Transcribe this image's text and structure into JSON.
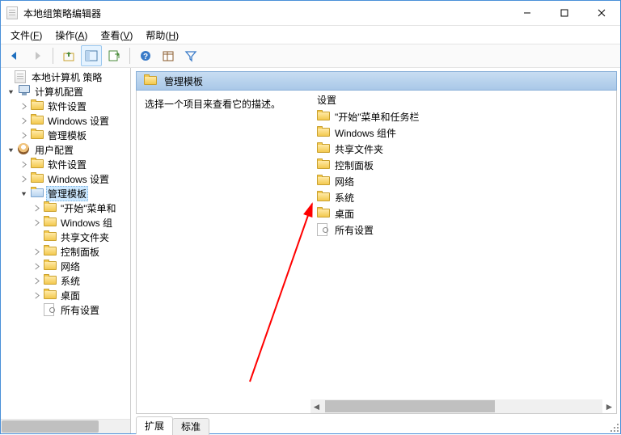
{
  "window": {
    "title": "本地组策略编辑器"
  },
  "menu": {
    "file": {
      "label": "文件",
      "accel": "F"
    },
    "action": {
      "label": "操作",
      "accel": "A"
    },
    "view": {
      "label": "查看",
      "accel": "V"
    },
    "help": {
      "label": "帮助",
      "accel": "H"
    }
  },
  "tree": {
    "root": {
      "label": "本地计算机 策略"
    },
    "computer_cfg": {
      "label": "计算机配置"
    },
    "computer_children": {
      "software": "软件设置",
      "windows": "Windows 设置",
      "admin": "管理模板"
    },
    "user_cfg": {
      "label": "用户配置"
    },
    "user_children": {
      "software": "软件设置",
      "windows": "Windows 设置",
      "admin": "管理模板"
    },
    "admin_children": {
      "startmenu": "\"开始\"菜单和",
      "win_comp": "Windows 组",
      "shared": "共享文件夹",
      "control": "控制面板",
      "network": "网络",
      "system": "系统",
      "desktop": "桌面",
      "all": "所有设置"
    }
  },
  "breadcrumb": {
    "label": "管理模板"
  },
  "description": {
    "hint": "选择一个项目来查看它的描述。",
    "header": "设置"
  },
  "list": [
    {
      "key": "startmenu",
      "label": "\"开始\"菜单和任务栏"
    },
    {
      "key": "win_comp",
      "label": "Windows 组件"
    },
    {
      "key": "shared",
      "label": "共享文件夹"
    },
    {
      "key": "control",
      "label": "控制面板"
    },
    {
      "key": "network",
      "label": "网络"
    },
    {
      "key": "system",
      "label": "系统"
    },
    {
      "key": "desktop",
      "label": "桌面"
    },
    {
      "key": "all",
      "label": "所有设置",
      "icon": "page"
    }
  ],
  "tabs": {
    "extended": "扩展",
    "standard": "标准"
  }
}
